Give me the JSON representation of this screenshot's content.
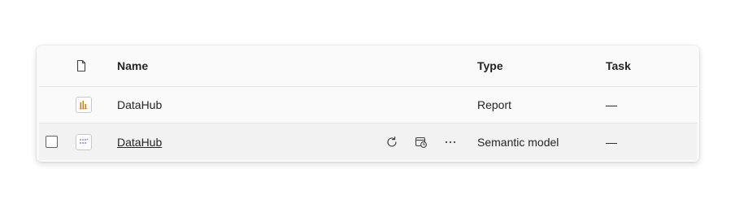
{
  "table": {
    "columns": {
      "icon": "file-icon",
      "name": "Name",
      "type": "Type",
      "task": "Task"
    },
    "rows": [
      {
        "icon": "report-icon",
        "name": "DataHub",
        "type": "Report",
        "task": "—",
        "selected": false,
        "hovered": false
      },
      {
        "icon": "semantic-model-icon",
        "name": "DataHub",
        "type": "Semantic model",
        "task": "—",
        "selected": false,
        "hovered": true,
        "actions": [
          "refresh-icon",
          "schedule-refresh-icon",
          "more-options-icon"
        ]
      }
    ]
  },
  "colors": {
    "report_icon": "#c8811a",
    "semantic_model_icon": "#6b63c9",
    "text": "#242424",
    "row_hover": "#f2f2f2"
  }
}
